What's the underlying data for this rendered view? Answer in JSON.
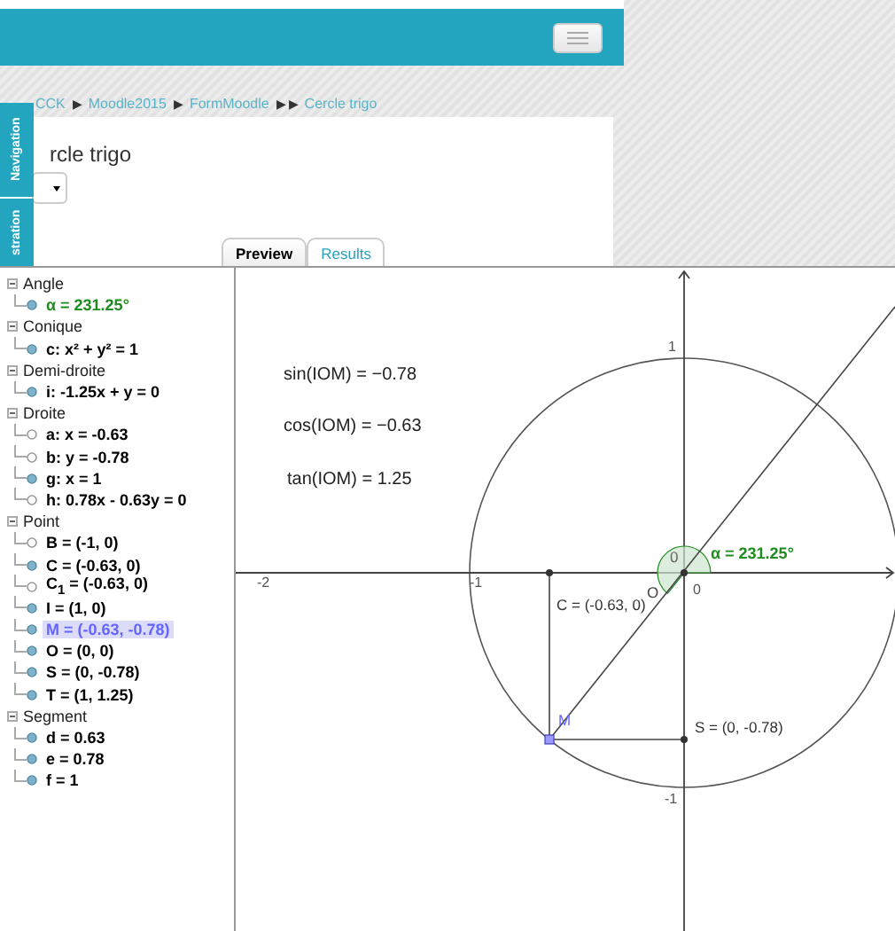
{
  "breadcrumb": [
    {
      "label": "CCK",
      "separator": "▶"
    },
    {
      "label": "Moodle2015",
      "separator": "▶"
    },
    {
      "label": "FormMoodle",
      "separator": "▶ ▶"
    },
    {
      "label": "Cercle trigo"
    }
  ],
  "side_tabs": [
    "Navigation",
    "stration"
  ],
  "page_title": "rcle trigo",
  "tabs": [
    {
      "label": "Preview",
      "selected": true
    },
    {
      "label": "Results",
      "selected": false
    }
  ],
  "algebra": [
    {
      "label": "Angle",
      "expanded": true,
      "children": [
        {
          "label": "α = 231.25°",
          "visible": true,
          "selected": false,
          "color": "#1e8c1e"
        }
      ]
    },
    {
      "label": "Conique",
      "expanded": true,
      "children": [
        {
          "label": "c: x² + y² = 1",
          "visible": true,
          "selected": false,
          "color": "#000000"
        }
      ]
    },
    {
      "label": "Demi-droite",
      "expanded": true,
      "children": [
        {
          "label": "i: -1.25x + y = 0",
          "visible": true,
          "selected": false,
          "color": "#000000"
        }
      ]
    },
    {
      "label": "Droite",
      "expanded": true,
      "children": [
        {
          "label": "a: x = -0.63",
          "visible": false,
          "selected": false,
          "color": "#000000"
        },
        {
          "label": "b: y = -0.78",
          "visible": false,
          "selected": false,
          "color": "#000000"
        },
        {
          "label": "g: x = 1",
          "visible": true,
          "selected": false,
          "color": "#000000"
        },
        {
          "label": "h: 0.78x - 0.63y = 0",
          "visible": false,
          "selected": false,
          "color": "#000000"
        }
      ]
    },
    {
      "label": "Point",
      "expanded": true,
      "children": [
        {
          "label": "B = (-1, 0)",
          "visible": false,
          "selected": false,
          "color": "#000000"
        },
        {
          "label": "C = (-0.63, 0)",
          "visible": true,
          "selected": false,
          "color": "#000000"
        },
        {
          "label": "C$_{1}$ = (-0.63, 0)",
          "visible": false,
          "selected": false,
          "color": "#000000"
        },
        {
          "label": "I = (1, 0)",
          "visible": true,
          "selected": false,
          "color": "#000000"
        },
        {
          "label": "M = (-0.63, -0.78)",
          "visible": true,
          "selected": true,
          "color": "#6464ff"
        },
        {
          "label": "O = (0, 0)",
          "visible": true,
          "selected": false,
          "color": "#000000"
        },
        {
          "label": "S = (0, -0.78)",
          "visible": true,
          "selected": false,
          "color": "#000000"
        },
        {
          "label": "T = (1, 1.25)",
          "visible": true,
          "selected": false,
          "color": "#000000"
        }
      ]
    },
    {
      "label": "Segment",
      "expanded": true,
      "children": [
        {
          "label": "d = 0.63",
          "visible": true,
          "selected": false,
          "color": "#000000"
        },
        {
          "label": "e = 0.78",
          "visible": true,
          "selected": false,
          "color": "#000000"
        },
        {
          "label": "f = 1",
          "visible": true,
          "selected": false,
          "color": "#000000"
        }
      ]
    }
  ],
  "graphics": {
    "formulas": [
      "sin(IOM) = −0.78",
      "cos(IOM) = −0.63",
      "tan(IOM) = 1.25"
    ],
    "x_ticks": [
      "-2",
      "-1",
      "0"
    ],
    "y_ticks": [
      "1",
      "-1"
    ],
    "labels": [
      {
        "text": "α = 231.25°",
        "color": "#1e8c1e"
      },
      {
        "text": "0",
        "color": "#666666"
      },
      {
        "text": "O",
        "color": "#444444"
      },
      {
        "text": "C = (-0.63, 0)",
        "color": "#333333"
      },
      {
        "text": "S = (0, -0.78)",
        "color": "#333333"
      },
      {
        "text": "M",
        "color": "#6464ff"
      }
    ]
  }
}
